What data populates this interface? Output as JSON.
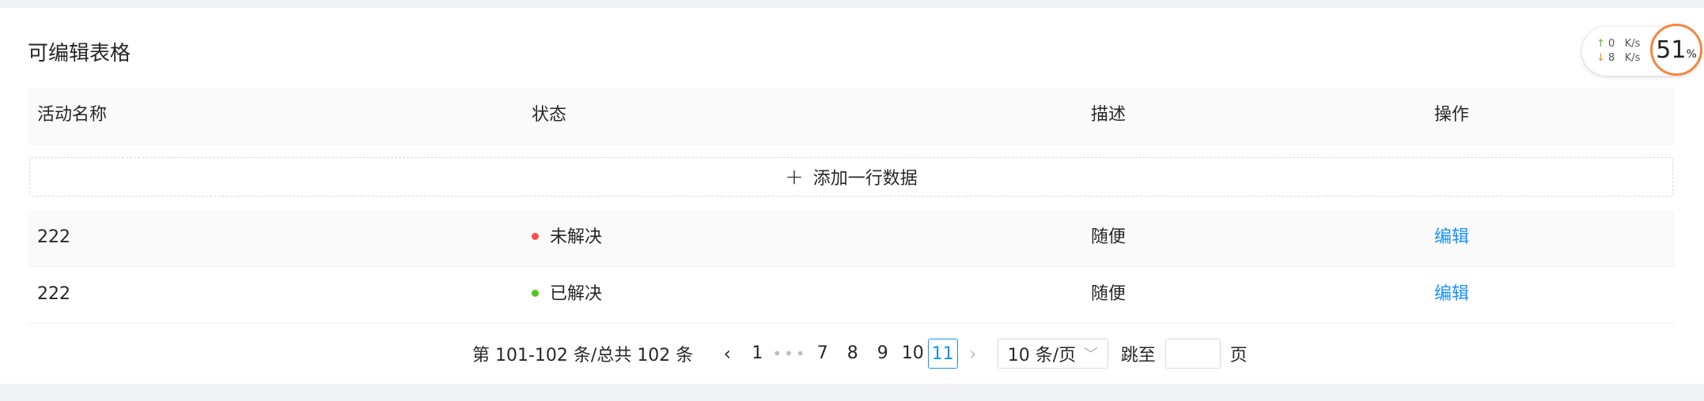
{
  "card": {
    "title": "可编辑表格"
  },
  "table": {
    "columns": [
      "活动名称",
      "状态",
      "描述",
      "操作"
    ],
    "add_row_label": "添加一行数据",
    "rows": [
      {
        "name": "222",
        "status": "未解决",
        "status_color": "#ff4d4f",
        "desc": "随便",
        "action": "编辑"
      },
      {
        "name": "222",
        "status": "已解决",
        "status_color": "#52c41a",
        "desc": "随便",
        "action": "编辑"
      }
    ]
  },
  "pagination": {
    "total_text": "第 101-102 条/总共 102 条",
    "prev_icon": "‹",
    "next_icon": "›",
    "pages": [
      "1",
      "7",
      "8",
      "9",
      "10",
      "11"
    ],
    "ellipsis": "•••",
    "current": "11",
    "page_size": "10 条/页",
    "jump_label": "跳至",
    "page_suffix": "页"
  },
  "net_monitor": {
    "up_value": "0",
    "down_value": "8",
    "unit": "K/s",
    "percent": "51",
    "percent_sign": "%"
  }
}
